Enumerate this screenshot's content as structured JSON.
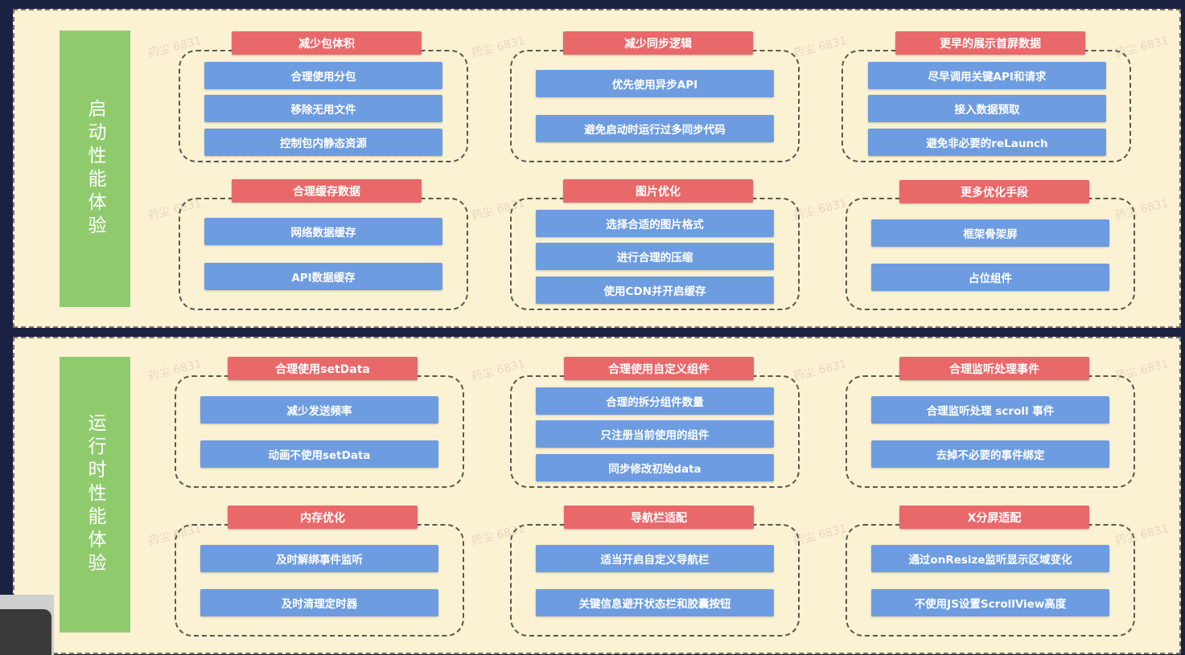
{
  "sections": {
    "startup": {
      "title": "启动性能体验",
      "groups": [
        {
          "title": "减少包体积",
          "items": [
            "合理使用分包",
            "移除无用文件",
            "控制包内静态资源"
          ]
        },
        {
          "title": "减少同步逻辑",
          "items": [
            "优先使用异步API",
            "避免启动时运行过多同步代码"
          ]
        },
        {
          "title": "更早的展示首屏数据",
          "items": [
            "尽早调用关键API和请求",
            "接入数据预取",
            "避免非必要的reLaunch"
          ]
        },
        {
          "title": "合理缓存数据",
          "items": [
            "网络数据缓存",
            "API数据缓存"
          ]
        },
        {
          "title": "图片优化",
          "items": [
            "选择合适的图片格式",
            "进行合理的压缩",
            "使用CDN并开启缓存"
          ]
        },
        {
          "title": "更多优化手段",
          "items": [
            "框架骨架屏",
            "占位组件"
          ]
        }
      ]
    },
    "runtime": {
      "title": "运行时性能体验",
      "groups": [
        {
          "title": "合理使用setData",
          "items": [
            "减少发送频率",
            "动画不使用setData"
          ]
        },
        {
          "title": "合理使用自定义组件",
          "items": [
            "合理的拆分组件数量",
            "只注册当前使用的组件",
            "同步修改初始data"
          ]
        },
        {
          "title": "合理监听处理事件",
          "items": [
            "合理监听处理 scroll 事件",
            "去掉不必要的事件绑定"
          ]
        },
        {
          "title": "内存优化",
          "items": [
            "及时解绑事件监听",
            "及时清理定时器"
          ]
        },
        {
          "title": "导航栏适配",
          "items": [
            "适当开启自定义导航栏",
            "关键信息避开状态栏和胶囊按钮"
          ]
        },
        {
          "title": "X分屏适配",
          "items": [
            "通过onResize监听显示区域变化",
            "不使用JS设置ScrollView高度"
          ]
        }
      ]
    }
  },
  "watermark": "药尘 6831",
  "colors": {
    "background": "#fbf2d3",
    "side_label": "#8fcb6d",
    "group_title": "#e9686a",
    "item": "#6d9ce0"
  }
}
